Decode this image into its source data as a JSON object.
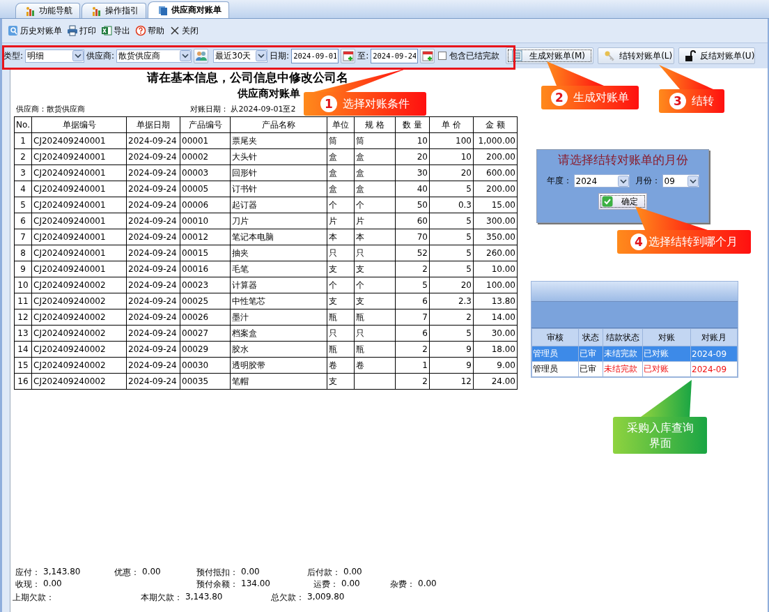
{
  "tabs": [
    {
      "label": "功能导航",
      "selected": false
    },
    {
      "label": "操作指引",
      "selected": false
    },
    {
      "label": "供应商对账单",
      "selected": true
    }
  ],
  "toolbar": [
    {
      "label": "历史对账单"
    },
    {
      "label": "打印"
    },
    {
      "label": "导出"
    },
    {
      "label": "帮助"
    },
    {
      "label": "关闭"
    }
  ],
  "filters": {
    "type_label": "类型:",
    "type_value": "明细",
    "supplier_label": "供应商:",
    "supplier_value": "散货供应商",
    "period_value": "最近30天",
    "date_label": "日期:",
    "date_from": "2024-09-01",
    "to_label": "至:",
    "date_to": "2024-09-24",
    "include_settled": {
      "label": "包含已结完款",
      "checked": false
    }
  },
  "actions": [
    {
      "label": "生成对账单(M)",
      "focused": true
    },
    {
      "label": "结转对账单(L)",
      "focused": false
    },
    {
      "label": "反结对账单(U)",
      "focused": false
    }
  ],
  "report": {
    "company": "请在基本信息，公司信息中修改公司名",
    "title": "供应商对账单",
    "supplier": "供应商：散货供应商",
    "date_range": "对账日期：  从2024-09-01至2",
    "columns": [
      "No.",
      "单据编号",
      "单据日期",
      "产品编号",
      "产品名称",
      "单位",
      "规 格",
      "数 量",
      "单 价",
      "金 额"
    ],
    "rows": [
      [
        "1",
        "CJ202409240001",
        "2024-09-24",
        "00001",
        "票尾夹",
        "筒",
        "筒",
        "10",
        "100",
        "1,000.00"
      ],
      [
        "2",
        "CJ202409240001",
        "2024-09-24",
        "00002",
        "大头针",
        "盒",
        "盒",
        "20",
        "10",
        "200.00"
      ],
      [
        "3",
        "CJ202409240001",
        "2024-09-24",
        "00003",
        "回形针",
        "盒",
        "盒",
        "30",
        "20",
        "600.00"
      ],
      [
        "4",
        "CJ202409240001",
        "2024-09-24",
        "00005",
        "订书针",
        "盒",
        "盒",
        "40",
        "5",
        "200.00"
      ],
      [
        "5",
        "CJ202409240001",
        "2024-09-24",
        "00006",
        "起订器",
        "个",
        "个",
        "50",
        "0.3",
        "15.00"
      ],
      [
        "6",
        "CJ202409240001",
        "2024-09-24",
        "00010",
        "刀片",
        "片",
        "片",
        "60",
        "5",
        "300.00"
      ],
      [
        "7",
        "CJ202409240001",
        "2024-09-24",
        "00012",
        "笔记本电脑",
        "本",
        "本",
        "70",
        "5",
        "350.00"
      ],
      [
        "8",
        "CJ202409240001",
        "2024-09-24",
        "00015",
        "抽夹",
        "只",
        "只",
        "52",
        "5",
        "260.00"
      ],
      [
        "9",
        "CJ202409240001",
        "2024-09-24",
        "00016",
        "毛笔",
        "支",
        "支",
        "2",
        "5",
        "10.00"
      ],
      [
        "10",
        "CJ202409240002",
        "2024-09-24",
        "00023",
        "计算器",
        "个",
        "个",
        "5",
        "20",
        "100.00"
      ],
      [
        "11",
        "CJ202409240002",
        "2024-09-24",
        "00025",
        "中性笔芯",
        "支",
        "支",
        "6",
        "2.3",
        "13.80"
      ],
      [
        "12",
        "CJ202409240002",
        "2024-09-24",
        "00026",
        "墨汁",
        "瓶",
        "瓶",
        "7",
        "2",
        "14.00"
      ],
      [
        "13",
        "CJ202409240002",
        "2024-09-24",
        "00027",
        "档案盒",
        "只",
        "只",
        "6",
        "5",
        "30.00"
      ],
      [
        "14",
        "CJ202409240002",
        "2024-09-24",
        "00029",
        "胶水",
        "瓶",
        "瓶",
        "2",
        "9",
        "18.00"
      ],
      [
        "15",
        "CJ202409240002",
        "2024-09-24",
        "00030",
        "透明胶带",
        "卷",
        "卷",
        "1",
        "9",
        "9.00"
      ],
      [
        "16",
        "CJ202409240002",
        "2024-09-24",
        "00035",
        "笔帽",
        "支",
        "",
        "2",
        "12",
        "24.00"
      ]
    ]
  },
  "totals": [
    [
      {
        "label": "应付：",
        "value": "3,143.80"
      },
      {
        "label": "优惠：",
        "value": "0.00"
      },
      {
        "label": "预付抵扣：",
        "value": "0.00"
      },
      {
        "label": "后付款：",
        "value": "0.00"
      }
    ],
    [
      {
        "label": "收现：",
        "value": "0.00"
      },
      {
        "label": "预付余额：",
        "value": "134.00"
      },
      {
        "label": "运费：",
        "value": "0.00"
      },
      {
        "label": "杂费：",
        "value": "0.00"
      }
    ],
    [
      {
        "label": "上期欠款："
      },
      {
        "label": "本期欠款：",
        "value": "3,143.80"
      },
      {
        "label": "总欠款：",
        "value": "3,009.80"
      }
    ]
  ],
  "month_dialog": {
    "title": "请选择结转对账单的月份",
    "year_label": "年度：",
    "year": "2024",
    "month_label": "月份：",
    "month": "09",
    "ok": "确定"
  },
  "purchase_grid": {
    "columns": [
      "审核",
      "状态",
      "结款状态",
      "对账",
      "对账月"
    ],
    "rows": [
      {
        "cells": [
          "管理员",
          "已审",
          "未结完款",
          "已对账",
          "2024-09"
        ],
        "selected": true,
        "flagged": false
      },
      {
        "cells": [
          "管理员",
          "已审",
          "未结完款",
          "已对账",
          "2024-09"
        ],
        "selected": false,
        "flagged": true
      }
    ]
  },
  "callouts": [
    {
      "kind": "red",
      "number": "1",
      "text": "选择对账条件"
    },
    {
      "kind": "red",
      "number": "2",
      "text": "生成对账单"
    },
    {
      "kind": "red",
      "number": "3",
      "text": "结转"
    },
    {
      "kind": "red",
      "number": "4",
      "text": "选择结转到哪个月"
    },
    {
      "kind": "green",
      "text": "采购入库查询界面"
    }
  ]
}
